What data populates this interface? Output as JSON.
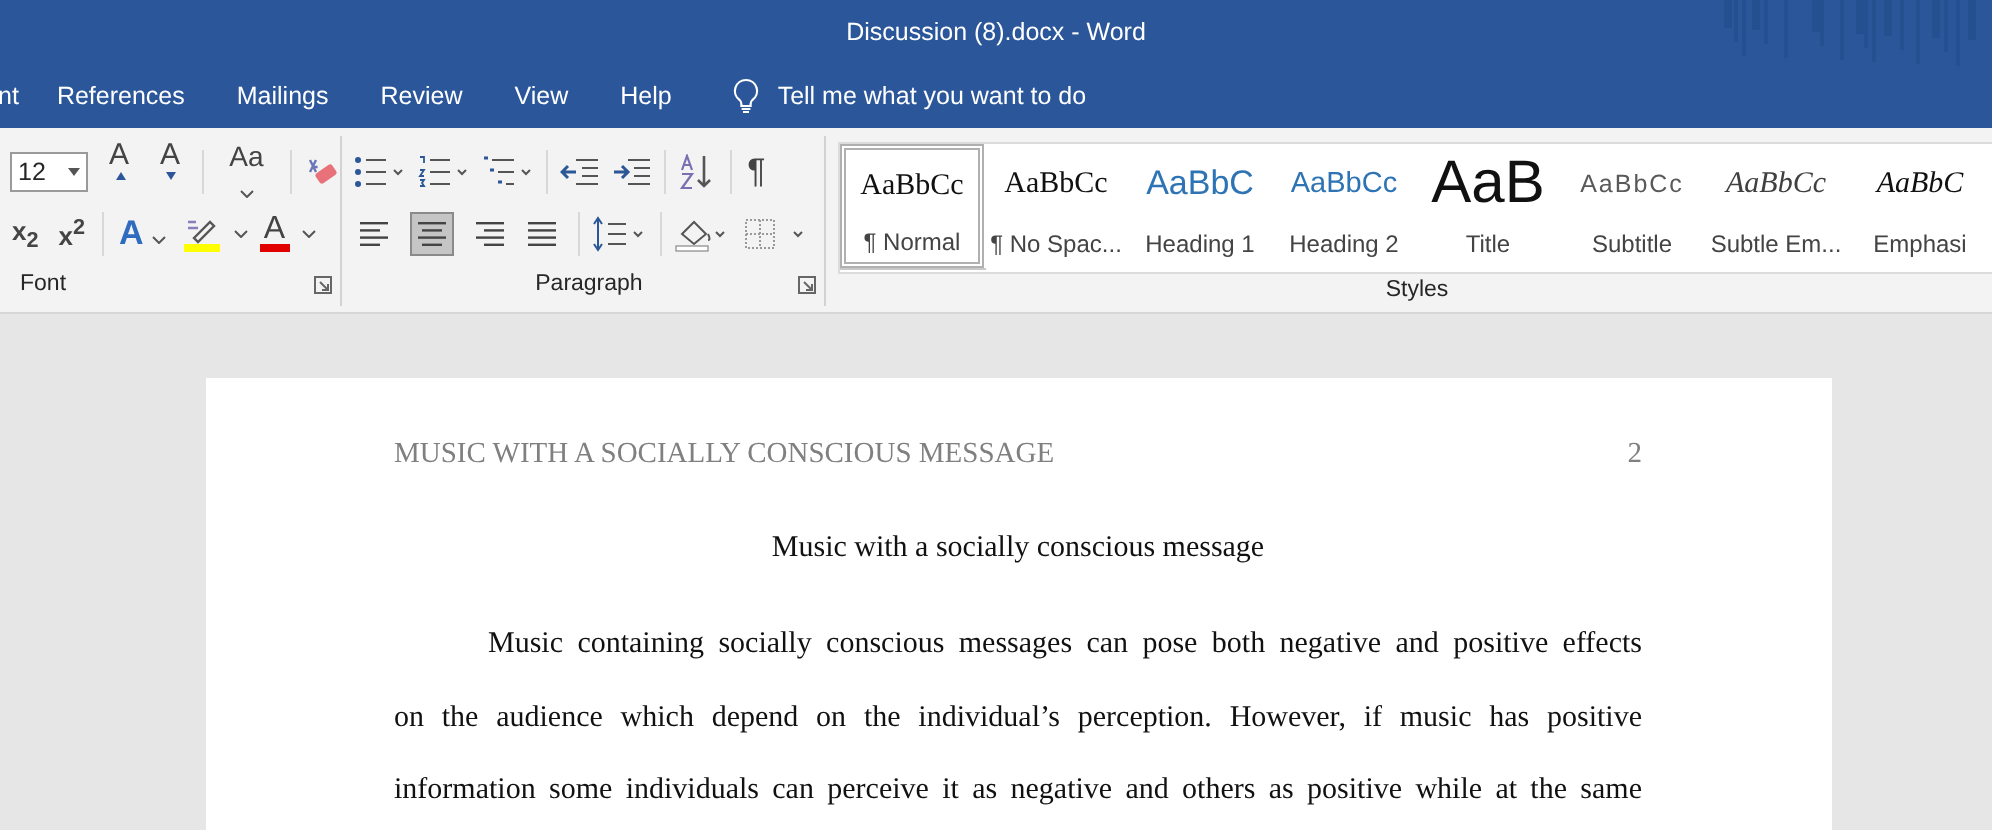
{
  "window": {
    "title": "Discussion (8).docx  -  Word"
  },
  "tabs": [
    {
      "label": "nt",
      "selected": false
    },
    {
      "label": "References",
      "selected": false
    },
    {
      "label": "Mailings",
      "selected": false
    },
    {
      "label": "Review",
      "selected": false
    },
    {
      "label": "View",
      "selected": false
    },
    {
      "label": "Help",
      "selected": false
    }
  ],
  "tell_me": {
    "placeholder": "Tell me what you want to do"
  },
  "font_group": {
    "label": "Font",
    "size": "12",
    "grow": "A",
    "shrink": "A",
    "change_case": "Aa",
    "subscript": "x$_{2}$",
    "superscript": "x$^{2}$",
    "text_effects": "A",
    "font_color": "A"
  },
  "paragraph_group": {
    "label": "Paragraph",
    "pilcrow": "¶",
    "alignment": [
      {
        "kind": "left",
        "selected": false
      },
      {
        "kind": "center",
        "selected": true
      },
      {
        "kind": "right",
        "selected": false
      },
      {
        "kind": "justify",
        "selected": false
      }
    ]
  },
  "styles_group": {
    "label": "Styles",
    "styles": [
      {
        "kind": "normal",
        "preview": "AaBbCc",
        "label": "¶ Normal",
        "selected": true
      },
      {
        "kind": "nospacing",
        "preview": "AaBbCc",
        "label": "¶ No Spac...",
        "selected": false
      },
      {
        "kind": "heading1",
        "preview": "AaBbC",
        "label": "Heading 1",
        "selected": false
      },
      {
        "kind": "heading2",
        "preview": "AaBbCc",
        "label": "Heading 2",
        "selected": false
      },
      {
        "kind": "title",
        "preview": "AaB",
        "label": "Title",
        "selected": false
      },
      {
        "kind": "subtitle",
        "preview": "AaBbCc",
        "label": "Subtitle",
        "selected": false
      },
      {
        "kind": "subtle",
        "preview": "AaBbCc",
        "label": "Subtle Em...",
        "selected": false
      },
      {
        "kind": "emphasis",
        "preview": "AaBbC",
        "label": "Emphasi",
        "selected": false
      }
    ]
  },
  "document": {
    "header": "MUSIC WITH A SOCIALLY CONSCIOUS MESSAGE",
    "page_number": "2",
    "title": "Music with a socially conscious message",
    "lines": [
      "Music containing socially conscious messages can pose both negative and positive effects",
      "on the audience which depend on the individual’s perception. However, if music has positive",
      "information some individuals can perceive it as negative and others as positive while at the same"
    ]
  }
}
